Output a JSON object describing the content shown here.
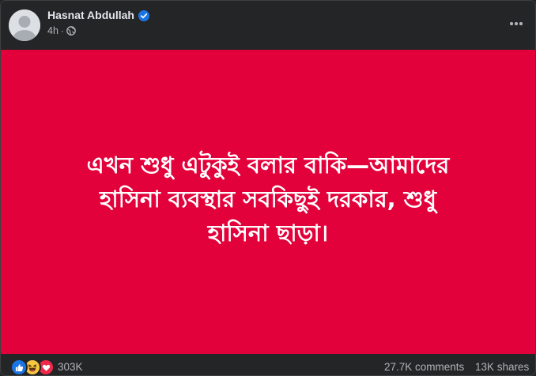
{
  "post": {
    "author": "Hasnat Abdullah",
    "time": "4h",
    "privacy_icon": "globe-icon",
    "verified_icon": "verified-badge-icon",
    "more_icon": "more-options-icon",
    "background_color": "#e2013a",
    "text_lines": [
      "এখন শুধু এটুকুই বলার বাকি—আমাদের",
      "হাসিনা ব্যবস্থার সবকিছুই দরকার, শুধু",
      "হাসিনা ছাড়া।"
    ]
  },
  "footer": {
    "reactions": [
      "like-icon",
      "haha-icon",
      "love-icon"
    ],
    "reaction_count": "303K",
    "comments": "27.7K comments",
    "shares": "13K shares"
  }
}
